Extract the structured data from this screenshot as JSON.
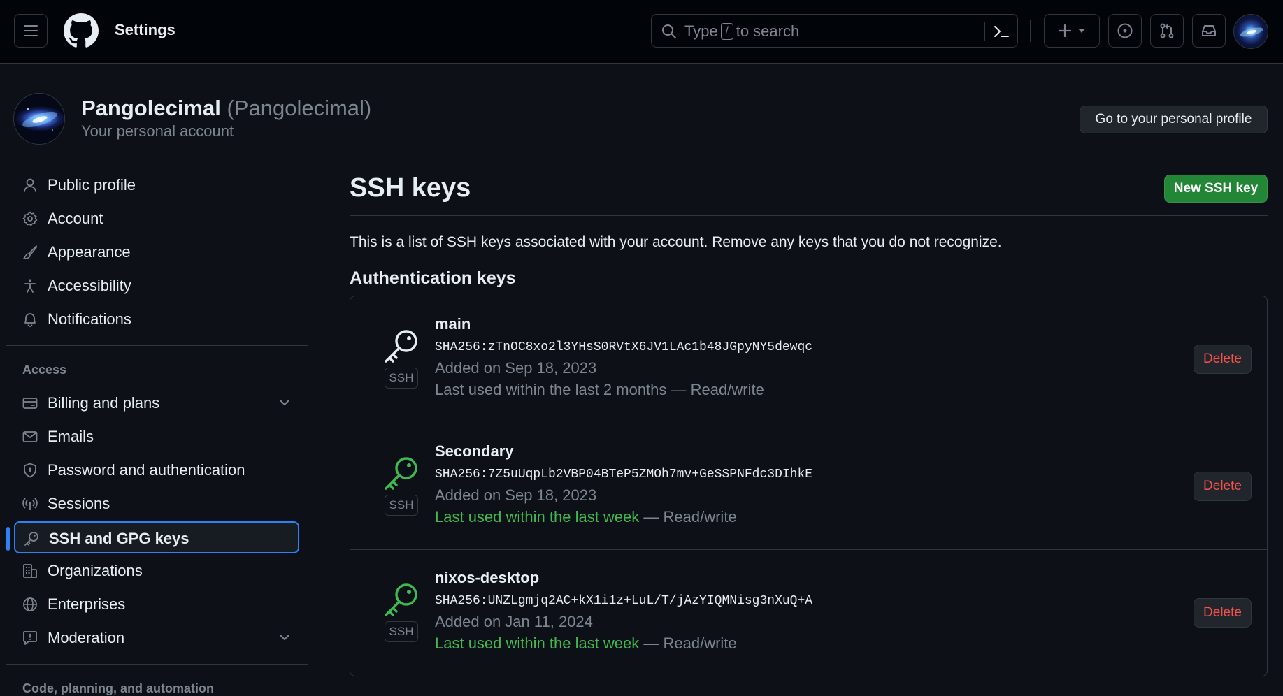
{
  "header": {
    "context_title": "Settings",
    "search_prefix": "Type",
    "search_kbd": "/",
    "search_suffix": "to search"
  },
  "account": {
    "display_name": "Pangolecimal",
    "login_paren": "(Pangolecimal)",
    "subtitle": "Your personal account",
    "profile_button": "Go to your personal profile"
  },
  "sidebar": {
    "items": [
      {
        "label": "Public profile",
        "icon": "person-icon"
      },
      {
        "label": "Account",
        "icon": "gear-icon"
      },
      {
        "label": "Appearance",
        "icon": "paintbrush-icon"
      },
      {
        "label": "Accessibility",
        "icon": "accessibility-icon"
      },
      {
        "label": "Notifications",
        "icon": "bell-icon"
      }
    ],
    "access_heading": "Access",
    "access_items": [
      {
        "label": "Billing and plans",
        "icon": "credit-card-icon"
      },
      {
        "label": "Emails",
        "icon": "mail-icon"
      },
      {
        "label": "Password and authentication",
        "icon": "shield-lock-icon"
      },
      {
        "label": "Sessions",
        "icon": "broadcast-icon"
      },
      {
        "label": "SSH and GPG keys",
        "icon": "key-icon",
        "active": true
      },
      {
        "label": "Organizations",
        "icon": "organization-icon"
      },
      {
        "label": "Enterprises",
        "icon": "globe-icon"
      },
      {
        "label": "Moderation",
        "icon": "report-icon"
      }
    ],
    "next_heading": "Code, planning, and automation"
  },
  "main": {
    "title": "SSH keys",
    "new_key_button": "New SSH key",
    "description": "This is a list of SSH keys associated with your account. Remove any keys that you do not recognize.",
    "auth_heading": "Authentication keys",
    "keys": [
      {
        "title": "main",
        "badge": "SSH",
        "fingerprint": "SHA256:zTnOC8xo2l3YHsS0RVtX6JV1LAc1b48JGpyNY5dewqc",
        "added": "Added on Sep 18, 2023",
        "last_used_prefix": "Last used within the last 2 months",
        "last_used_recent": "",
        "access": " — Read/write",
        "delete_label": "Delete",
        "icon_color": "#e6edf3"
      },
      {
        "title": "Secondary",
        "badge": "SSH",
        "fingerprint": "SHA256:7Z5uUqpLb2VBP04BTeP5ZMOh7mv+GeSSPNFdc3DIhkE",
        "added": "Added on Sep 18, 2023",
        "last_used_prefix": "",
        "last_used_recent": "Last used within the last week",
        "access": " — Read/write",
        "delete_label": "Delete",
        "icon_color": "#3fb950"
      },
      {
        "title": "nixos-desktop",
        "badge": "SSH",
        "fingerprint": "SHA256:UNZLgmjq2AC+kX1i1z+LuL/T/jAzYIQMNisg3nXuQ+A",
        "added": "Added on Jan 11, 2024",
        "last_used_prefix": "",
        "last_used_recent": "Last used within the last week",
        "access": " — Read/write",
        "delete_label": "Delete",
        "icon_color": "#3fb950"
      }
    ]
  },
  "colors": {
    "background": "#0d1117",
    "accent": "#2f81f7",
    "primary_button": "#238636",
    "danger": "#f85149",
    "success": "#3fb950"
  }
}
